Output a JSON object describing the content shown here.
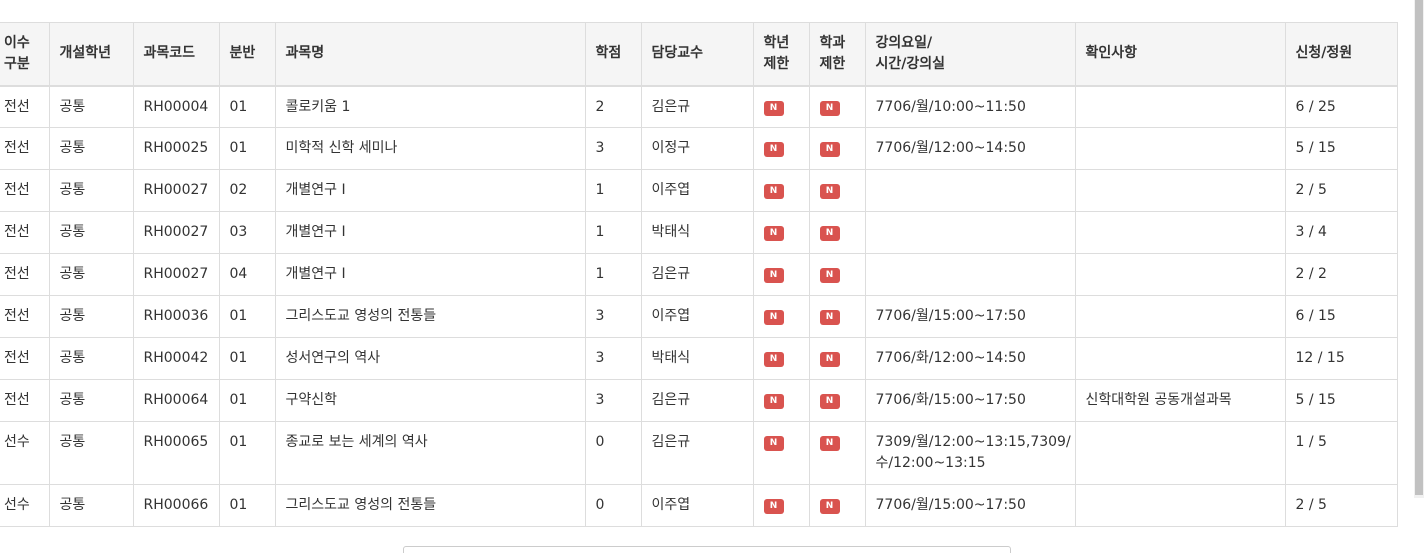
{
  "table": {
    "headers": {
      "category": "이수\n구분",
      "grade_open": "개설학년",
      "code": "과목코드",
      "section": "분반",
      "name": "과목명",
      "credit": "학점",
      "professor": "담당교수",
      "year_limit": "학년\n제한",
      "dept_limit": "학과\n제한",
      "schedule": "강의요일/\n시간/강의실",
      "note": "확인사항",
      "enroll": "신청/정원"
    },
    "badge_label": "N",
    "badge_color": "#d9534f",
    "rows": [
      {
        "category": "전선",
        "grade_open": "공통",
        "code": "RH00004",
        "section": "01",
        "name": "콜로키움 1",
        "credit": "2",
        "professor": "김은규",
        "schedule": "7706/월/10:00~11:50",
        "note": "",
        "enroll": "6 / 25"
      },
      {
        "category": "전선",
        "grade_open": "공통",
        "code": "RH00025",
        "section": "01",
        "name": "미학적 신학 세미나",
        "credit": "3",
        "professor": "이정구",
        "schedule": "7706/월/12:00~14:50",
        "note": "",
        "enroll": "5 / 15"
      },
      {
        "category": "전선",
        "grade_open": "공통",
        "code": "RH00027",
        "section": "02",
        "name": "개별연구 I",
        "credit": "1",
        "professor": "이주엽",
        "schedule": "",
        "note": "",
        "enroll": "2 / 5"
      },
      {
        "category": "전선",
        "grade_open": "공통",
        "code": "RH00027",
        "section": "03",
        "name": "개별연구 I",
        "credit": "1",
        "professor": "박태식",
        "schedule": "",
        "note": "",
        "enroll": "3 / 4"
      },
      {
        "category": "전선",
        "grade_open": "공통",
        "code": "RH00027",
        "section": "04",
        "name": "개별연구 I",
        "credit": "1",
        "professor": "김은규",
        "schedule": "",
        "note": "",
        "enroll": "2 / 2"
      },
      {
        "category": "전선",
        "grade_open": "공통",
        "code": "RH00036",
        "section": "01",
        "name": "그리스도교 영성의 전통들",
        "credit": "3",
        "professor": "이주엽",
        "schedule": "7706/월/15:00~17:50",
        "note": "",
        "enroll": "6 / 15"
      },
      {
        "category": "전선",
        "grade_open": "공통",
        "code": "RH00042",
        "section": "01",
        "name": "성서연구의 역사",
        "credit": "3",
        "professor": "박태식",
        "schedule": "7706/화/12:00~14:50",
        "note": "",
        "enroll": "12 / 15"
      },
      {
        "category": "전선",
        "grade_open": "공통",
        "code": "RH00064",
        "section": "01",
        "name": "구약신학",
        "credit": "3",
        "professor": "김은규",
        "schedule": "7706/화/15:00~17:50",
        "note": "신학대학원 공동개설과목",
        "enroll": "5 / 15"
      },
      {
        "category": "선수",
        "grade_open": "공통",
        "code": "RH00065",
        "section": "01",
        "name": "종교로 보는 세계의 역사",
        "credit": "0",
        "professor": "김은규",
        "schedule": "7309/월/12:00~13:15,7309/\n수/12:00~13:15",
        "note": "",
        "enroll": "1 / 5"
      },
      {
        "category": "선수",
        "grade_open": "공통",
        "code": "RH00066",
        "section": "01",
        "name": "그리스도교 영성의 전통들",
        "credit": "0",
        "professor": "이주엽",
        "schedule": "7706/월/15:00~17:50",
        "note": "",
        "enroll": "2 / 5"
      }
    ]
  }
}
